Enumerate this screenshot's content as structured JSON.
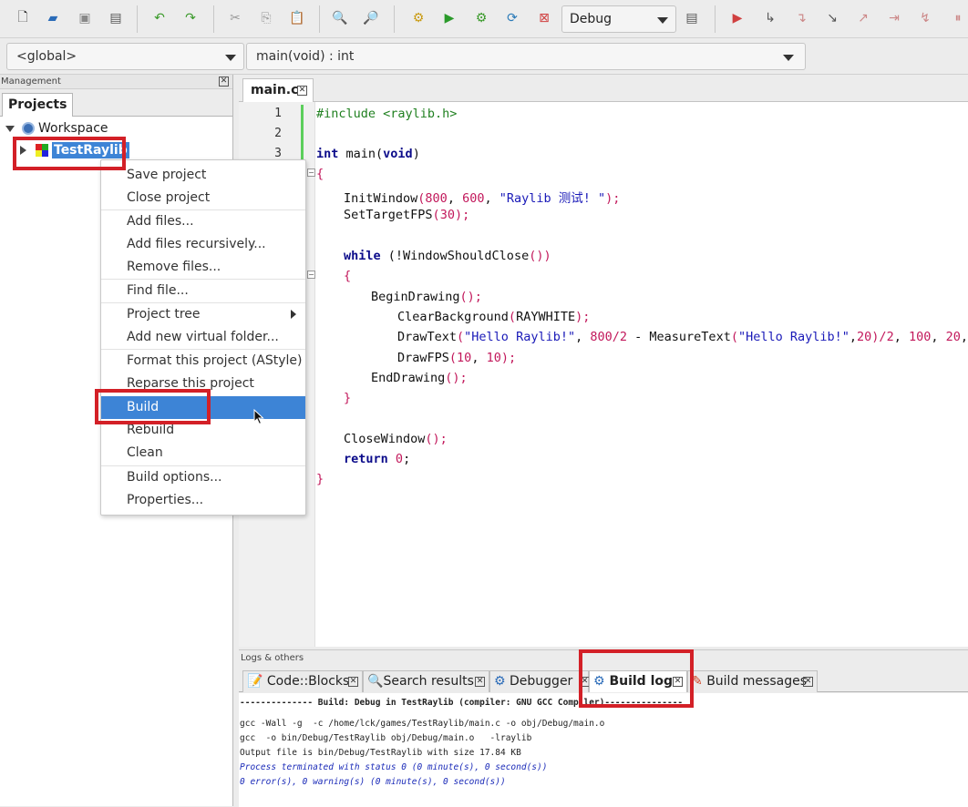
{
  "toolbar": {
    "build_target": "Debug"
  },
  "scope_bar": {
    "scope": "<global>",
    "function": "main(void) : int"
  },
  "management": {
    "title": "Management",
    "tab": "Projects",
    "workspace": "Workspace",
    "project": "TestRaylib"
  },
  "context_menu": {
    "items": [
      "Save project",
      "Close project",
      "Add files...",
      "Add files recursively...",
      "Remove files...",
      "Find file...",
      "Project tree",
      "Add new virtual folder...",
      "Format this project (AStyle)",
      "Reparse this project",
      "Build",
      "Rebuild",
      "Clean",
      "Build options...",
      "Properties..."
    ],
    "selected": "Build"
  },
  "editor": {
    "tab": "main.c",
    "line_numbers": [
      "1",
      "2",
      "3"
    ],
    "code": {
      "l1_include": "#include <raylib.h>",
      "l3_int": "int",
      "l3_rest": " main(",
      "l3_void": "void",
      "l3_close": ")",
      "l4": "{",
      "l5_fn": "InitWindow",
      "l5_args_a": "(",
      "l5_n1": "800",
      "l5_c1": ", ",
      "l5_n2": "600",
      "l5_c2": ", ",
      "l5_str": "\"Raylib 测试! \"",
      "l5_end": ");",
      "l6_fn": "SetTargetFPS",
      "l6_a": "(",
      "l6_n": "30",
      "l6_end": ");",
      "l8_kw": "while",
      "l8_rest": " (!WindowShouldClose",
      "l8_par": "())",
      "l9": "{",
      "l10_fn": "BeginDrawing",
      "l10_par": "();",
      "l11_fn": "ClearBackground",
      "l11_a": "(",
      "l11_arg": "RAYWHITE",
      "l11_end": ");",
      "l12_fn": "DrawText",
      "l12_a": "(",
      "l12_str": "\"Hello Raylib!\"",
      "l12_c1": ", ",
      "l12_n1": "800",
      "l12_div": "/",
      "l12_n2": "2",
      "l12_m": " - MeasureText",
      "l12_a2": "(",
      "l12_str2": "\"Hello Raylib!\"",
      "l12_c2": ",",
      "l12_n3": "20",
      "l12_e2": ")/",
      "l12_n4": "2",
      "l12_c3": ", ",
      "l12_n5": "100",
      "l12_c4": ", ",
      "l12_n6": "20",
      "l12_c5": ", RED",
      "l12_end": ");",
      "l13_fn": "DrawFPS",
      "l13_a": "(",
      "l13_n1": "10",
      "l13_c": ", ",
      "l13_n2": "10",
      "l13_end": ");",
      "l14_fn": "EndDrawing",
      "l14_par": "();",
      "l15": "}",
      "l17_fn": "CloseWindow",
      "l17_par": "();",
      "l18_kw": "return",
      "l18_sp": " ",
      "l18_n": "0",
      "l18_end": ";",
      "l19": "}"
    }
  },
  "logs": {
    "title": "Logs & others",
    "tabs": [
      "Code::Blocks",
      "Search results",
      "Debugger",
      "Build log",
      "Build messages"
    ],
    "active_tab": "Build log",
    "lines": [
      "-------------- Build: Debug in TestRaylib (compiler: GNU GCC Compiler)---------------",
      "gcc -Wall -g  -c /home/lck/games/TestRaylib/main.c -o obj/Debug/main.o",
      "gcc  -o bin/Debug/TestRaylib obj/Debug/main.o   -lraylib",
      "Output file is bin/Debug/TestRaylib with size 17.84 KB",
      "Process terminated with status 0 (0 minute(s), 0 second(s))",
      "0 error(s), 0 warning(s) (0 minute(s), 0 second(s))"
    ]
  },
  "colors": {
    "highlight_box": "#d32027",
    "menu_selection": "#3d84d6",
    "project_selection": "#3d84d6"
  }
}
